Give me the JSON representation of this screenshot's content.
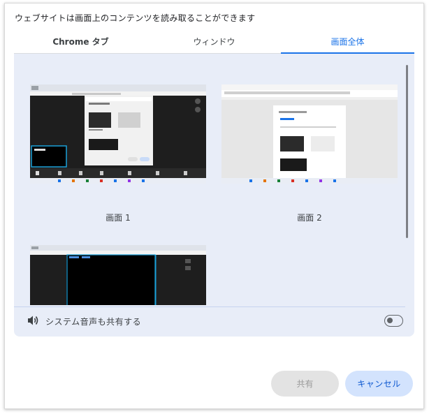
{
  "dialog": {
    "prompt": "ウェブサイトは画面上のコンテンツを読み取ることができます",
    "tabs": [
      {
        "label": "Chrome タブ",
        "active": false
      },
      {
        "label": "ウィンドウ",
        "active": false
      },
      {
        "label": "画面全体",
        "active": true
      }
    ],
    "screens": [
      {
        "label": "画面 1"
      },
      {
        "label": "画面 2"
      },
      {
        "label": ""
      }
    ],
    "audio": {
      "label": "システム音声も共有する",
      "enabled": false
    },
    "buttons": {
      "share": "共有",
      "cancel": "キャンセル"
    },
    "colors": {
      "accent": "#1a73e8",
      "panel": "#e8edf8",
      "cancel_bg": "#d3e3fd",
      "share_bg": "#e3e3e3"
    }
  }
}
